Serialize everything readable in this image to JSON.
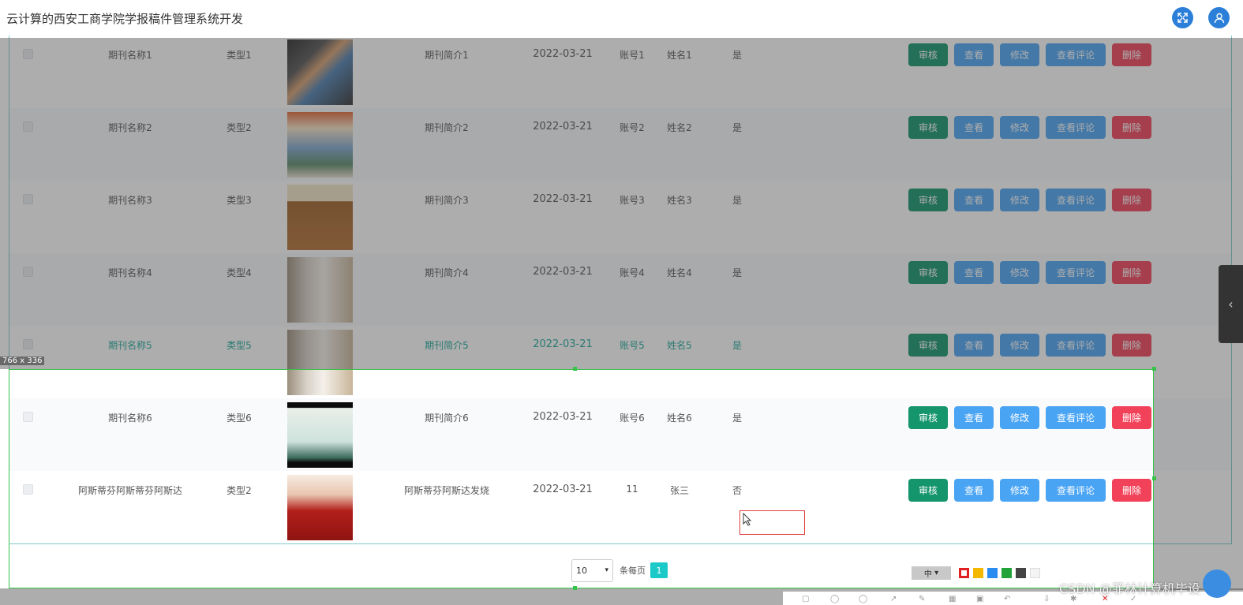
{
  "header": {
    "title": "云计算的西安工商学院学报稿件管理系统开发"
  },
  "rows": [
    {
      "name": "期刊名称1",
      "type": "类型1",
      "intro": "期刊简介1",
      "date": "2022-03-21",
      "account": "账号1",
      "person": "姓名1",
      "flag": "是"
    },
    {
      "name": "期刊名称2",
      "type": "类型2",
      "intro": "期刊简介2",
      "date": "2022-03-21",
      "account": "账号2",
      "person": "姓名2",
      "flag": "是"
    },
    {
      "name": "期刊名称3",
      "type": "类型3",
      "intro": "期刊简介3",
      "date": "2022-03-21",
      "account": "账号3",
      "person": "姓名3",
      "flag": "是"
    },
    {
      "name": "期刊名称4",
      "type": "类型4",
      "intro": "期刊简介4",
      "date": "2022-03-21",
      "account": "账号4",
      "person": "姓名4",
      "flag": "是"
    },
    {
      "name": "期刊名称5",
      "type": "类型5",
      "intro": "期刊简介5",
      "date": "2022-03-21",
      "account": "账号5",
      "person": "姓名5",
      "flag": "是"
    },
    {
      "name": "期刊名称6",
      "type": "类型6",
      "intro": "期刊简介6",
      "date": "2022-03-21",
      "account": "账号6",
      "person": "姓名6",
      "flag": "是"
    },
    {
      "name": "阿斯蒂芬阿斯蒂芬阿斯达",
      "type": "类型2",
      "intro": "阿斯蒂芬阿斯达发烧",
      "date": "2022-03-21",
      "account": "11",
      "person": "张三",
      "flag": "否"
    }
  ],
  "actions": {
    "audit": "审核",
    "view": "查看",
    "edit": "修改",
    "comments": "查看评论",
    "delete": "删除"
  },
  "pagination": {
    "page_size": "10",
    "per_page_label": "条每页",
    "current_page": "1"
  },
  "screenshot_tool": {
    "size_label": "766 x 336",
    "font_size": "中",
    "colors": [
      "#e02020",
      "#f5b800",
      "#2a8cf0",
      "#22a33a",
      "#444444",
      "#f4f4f4"
    ]
  },
  "watermark": "CSDN @菲林计算机毕设",
  "icons": {
    "fullscreen": "fullscreen-icon",
    "user": "user-icon",
    "sidebar_toggle": "chevron-left-icon"
  }
}
